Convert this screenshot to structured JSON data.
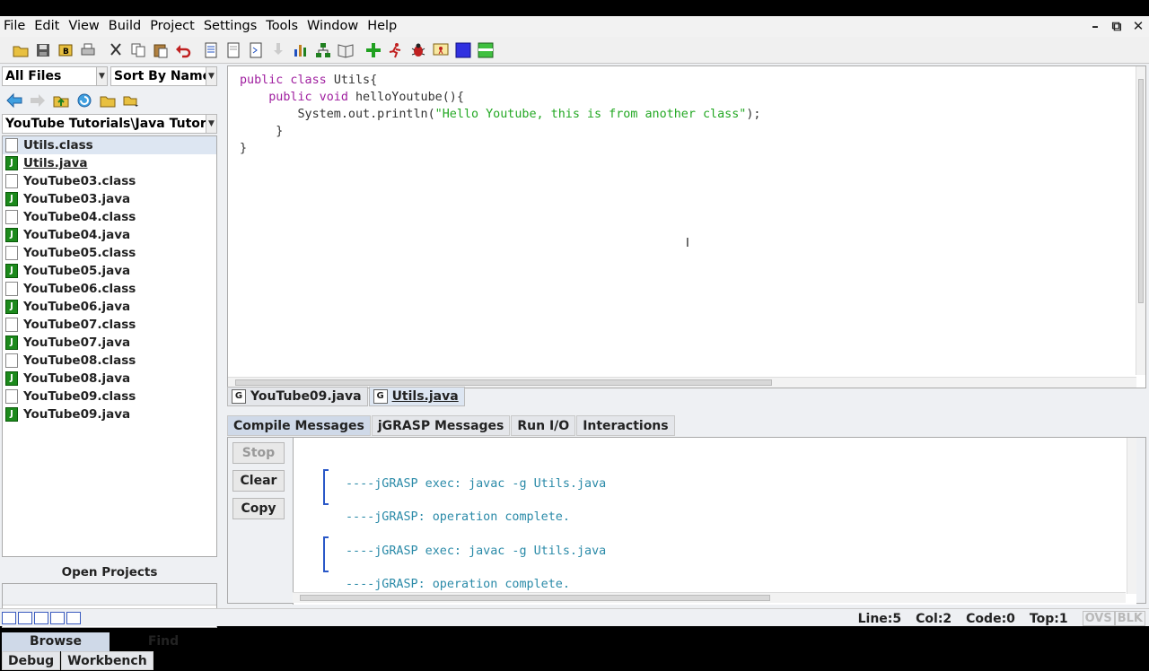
{
  "menubar": {
    "items": [
      "File",
      "Edit",
      "View",
      "Build",
      "Project",
      "Settings",
      "Tools",
      "Window",
      "Help"
    ]
  },
  "window_controls": [
    "minimize-icon",
    "restore-icon",
    "close-icon"
  ],
  "toolbar": {
    "icons": [
      "open-folder-icon",
      "save-icon",
      "browse-icon",
      "print-icon",
      "cut-icon",
      "copy-icon",
      "paste-icon",
      "undo-icon",
      "generate-csd-icon",
      "remove-csd-icon",
      "fold-icon",
      "pin-icon",
      "uml-icon",
      "tree-icon",
      "book-icon",
      "compile-icon",
      "run-icon",
      "debug-icon",
      "run-applet-icon",
      "stop-icon",
      "canvas-icon"
    ]
  },
  "browse": {
    "filter": "All Files",
    "sort": "Sort By Name",
    "path": "YouTube Tutorials\\Java Tutorials",
    "files": [
      {
        "name": "Utils.class",
        "type": "class",
        "selected": true
      },
      {
        "name": "Utils.java",
        "type": "java",
        "open": true
      },
      {
        "name": "YouTube03.class",
        "type": "class"
      },
      {
        "name": "YouTube03.java",
        "type": "java"
      },
      {
        "name": "YouTube04.class",
        "type": "class"
      },
      {
        "name": "YouTube04.java",
        "type": "java"
      },
      {
        "name": "YouTube05.class",
        "type": "class"
      },
      {
        "name": "YouTube05.java",
        "type": "java"
      },
      {
        "name": "YouTube06.class",
        "type": "class"
      },
      {
        "name": "YouTube06.java",
        "type": "java"
      },
      {
        "name": "YouTube07.class",
        "type": "class"
      },
      {
        "name": "YouTube07.java",
        "type": "java"
      },
      {
        "name": "YouTube08.class",
        "type": "class"
      },
      {
        "name": "YouTube08.java",
        "type": "java"
      },
      {
        "name": "YouTube09.class",
        "type": "class"
      },
      {
        "name": "YouTube09.java",
        "type": "java"
      }
    ],
    "open_projects_label": "Open Projects",
    "tabs": [
      "Browse",
      "Find"
    ],
    "bottom_tabs": [
      "Debug",
      "Workbench"
    ]
  },
  "editor": {
    "code": {
      "l1_kw": "public class ",
      "l1_rest": "Utils{",
      "l2_indent": "    ",
      "l2_kw": "public void ",
      "l2_rest": "helloYoutube(){",
      "l3_pre": "        System.out.println(",
      "l3_str": "\"Hello Youtube, this is from another class\"",
      "l3_post": ");",
      "l4": "     }",
      "l5": "}"
    },
    "tabs": [
      {
        "label": "YouTube09.java",
        "active": false
      },
      {
        "label": "Utils.java",
        "active": true
      }
    ]
  },
  "messages": {
    "tabs": [
      "Compile Messages",
      "jGRASP Messages",
      "Run I/O",
      "Interactions"
    ],
    "buttons": [
      "Stop",
      "Clear",
      "Copy"
    ],
    "lines": [
      "----jGRASP exec: javac -g Utils.java",
      "----jGRASP: operation complete.",
      "----jGRASP exec: javac -g Utils.java",
      "----jGRASP: operation complete."
    ]
  },
  "status": {
    "line": "Line:5",
    "col": "Col:2",
    "code": "Code:0",
    "top": "Top:1",
    "ovs": "OVS",
    "blk": "BLK"
  }
}
